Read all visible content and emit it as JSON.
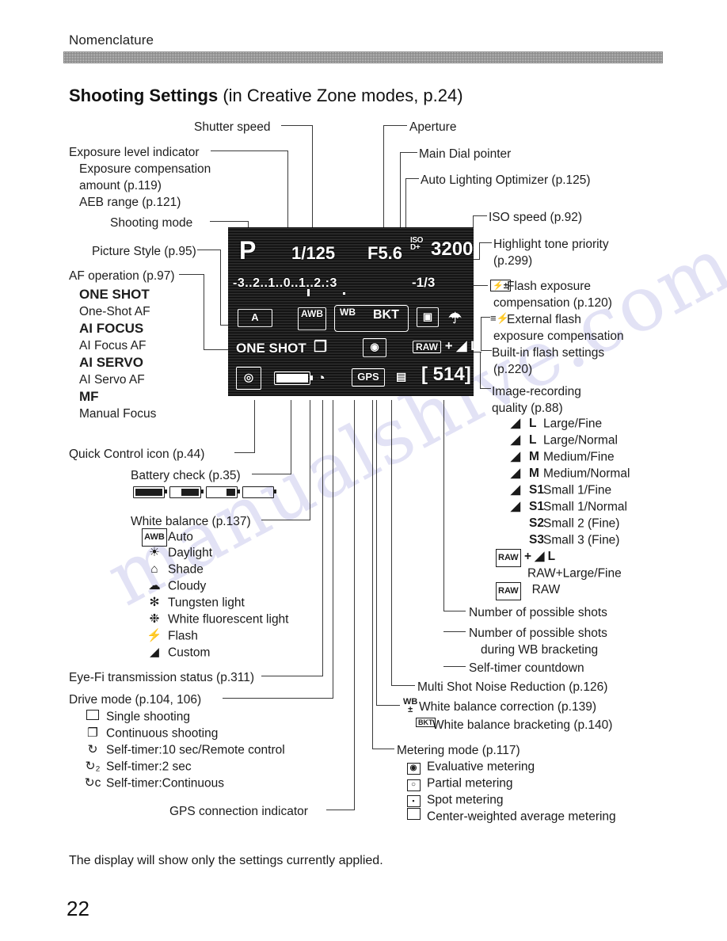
{
  "header": {
    "running_head": "Nomenclature",
    "section_title_bold": "Shooting Settings",
    "section_title_rest": " (in Creative Zone modes, p.24)"
  },
  "footer": {
    "note": "The display will show only the settings currently applied.",
    "page_number": "22"
  },
  "watermark": "manualshive.com",
  "lcd": {
    "shooting_mode": "P",
    "shutter_speed": "1/125",
    "aperture": "F5.6",
    "iso_label": "ISO",
    "highlight_tone": "D+",
    "iso_value": "3200",
    "ev_scale": "-3..2..1..0..1..2.:3",
    "flash_exp_comp": "-1/3",
    "picture_style": "A",
    "white_balance": "AWB",
    "wb_correction": "WB",
    "wb_bracketing": "BKT",
    "auto_lighting_optimizer": "ALO",
    "built_in_flash": "flash-icon",
    "af_operation": "ONE SHOT",
    "drive_mode": "continuous-icon",
    "metering_mode": "evaluative-icon",
    "image_quality": "RAW + L",
    "quick_control": "Q",
    "battery": "battery-full-icon",
    "eye_fi": "eyefi-icon",
    "gps": "GPS",
    "multi_shot_nr": "NR",
    "possible_shots": "[ 514]"
  },
  "callouts": {
    "shutter_speed": "Shutter speed",
    "aperture": "Aperture",
    "main_dial_pointer": "Main Dial pointer",
    "auto_lighting_optimizer": "Auto Lighting Optimizer (p.125)",
    "iso_speed": "ISO speed (p.92)",
    "exposure_level_indicator": "Exposure level indicator",
    "exposure_comp_amount_l1": "Exposure compensation",
    "exposure_comp_amount_l2": "amount (p.119)",
    "aeb_range": "AEB range (p.121)",
    "shooting_mode": "Shooting mode",
    "picture_style": "Picture Style (p.95)",
    "af_operation": "AF operation (p.97)",
    "quick_control_icon": "Quick Control icon (p.44)",
    "battery_check": "Battery check (p.35)",
    "white_balance": "White balance (p.137)",
    "eye_fi_status": "Eye-Fi transmission status (p.311)",
    "drive_mode": "Drive mode (p.104, 106)",
    "gps_indicator": "GPS connection indicator",
    "highlight_tone_priority_l1": "Highlight tone priority",
    "highlight_tone_priority_l2": "(p.299)",
    "flash_exp_comp_l1": "Flash exposure",
    "flash_exp_comp_l2": "compensation (p.120)",
    "external_flash_l1": "External flash",
    "external_flash_l2": "exposure compensation",
    "builtin_flash_l1": "Built-in flash settings",
    "builtin_flash_l2": "(p.220)",
    "image_quality_l1": "Image-recording",
    "image_quality_l2": "quality (p.88)",
    "possible_shots": "Number of possible shots",
    "possible_shots_wb_l1": "Number of possible shots",
    "possible_shots_wb_l2": "during WB bracketing",
    "selftimer_countdown": "Self-timer countdown",
    "multi_shot_nr": "Multi Shot Noise Reduction (p.126)",
    "wb_correction": "White balance correction (p.139)",
    "wb_bracketing": "White balance bracketing (p.140)",
    "metering_mode": "Metering mode (p.117)"
  },
  "af_list": [
    {
      "icon": "ONE SHOT",
      "label": "One-Shot AF"
    },
    {
      "icon": "AI FOCUS",
      "label": "AI Focus AF"
    },
    {
      "icon": "AI SERVO",
      "label": "AI Servo AF"
    },
    {
      "icon": "MF",
      "label": "Manual Focus"
    }
  ],
  "wb_list": [
    {
      "icon": "AWB",
      "glyph": "AWB",
      "label": "Auto"
    },
    {
      "icon": "sun-icon",
      "glyph": "☀",
      "label": "Daylight"
    },
    {
      "icon": "shade-icon",
      "glyph": "⌂",
      "label": "Shade"
    },
    {
      "icon": "cloud-icon",
      "glyph": "☁",
      "label": "Cloudy"
    },
    {
      "icon": "tungsten-icon",
      "glyph": "✻",
      "label": "Tungsten light"
    },
    {
      "icon": "fluorescent-icon",
      "glyph": "❉",
      "label": "White fluorescent light"
    },
    {
      "icon": "flash-icon",
      "glyph": "⚡",
      "label": "Flash"
    },
    {
      "icon": "custom-wb-icon",
      "glyph": "◢",
      "label": "Custom"
    }
  ],
  "drive_list": [
    {
      "icon": "single-shooting-icon",
      "glyph": "□",
      "label": "Single shooting"
    },
    {
      "icon": "continuous-shooting-icon",
      "glyph": "❐",
      "label": "Continuous shooting"
    },
    {
      "icon": "selftimer-10s-icon",
      "glyph": "↻",
      "label": "Self-timer:10 sec/Remote control"
    },
    {
      "icon": "selftimer-2s-icon",
      "glyph": "↻₂",
      "label": "Self-timer:2 sec"
    },
    {
      "icon": "selftimer-cont-icon",
      "glyph": "↻ᴄ",
      "label": "Self-timer:Continuous"
    }
  ],
  "quality_list": [
    {
      "icon": "fine-large-icon",
      "code": "L",
      "label": "Large/Fine"
    },
    {
      "icon": "normal-large-icon",
      "code": "L",
      "label": "Large/Normal"
    },
    {
      "icon": "fine-medium-icon",
      "code": "M",
      "label": "Medium/Fine"
    },
    {
      "icon": "normal-medium-icon",
      "code": "M",
      "label": "Medium/Normal"
    },
    {
      "icon": "fine-s1-icon",
      "code": "S1",
      "label": "Small 1/Fine"
    },
    {
      "icon": "normal-s1-icon",
      "code": "S1",
      "label": "Small 1/Normal"
    },
    {
      "icon": "s2-icon",
      "code": "S2",
      "label": "Small 2 (Fine)"
    },
    {
      "icon": "s3-icon",
      "code": "S3",
      "label": "Small 3 (Fine)"
    },
    {
      "icon": "raw-plus-large-icon",
      "code": "RAW + L",
      "label": "RAW+Large/Fine"
    },
    {
      "icon": "raw-icon",
      "code": "RAW",
      "label": "RAW"
    }
  ],
  "metering_list": [
    {
      "icon": "evaluative-metering-icon",
      "glyph": "◉",
      "label": "Evaluative metering"
    },
    {
      "icon": "partial-metering-icon",
      "glyph": "○",
      "label": "Partial metering"
    },
    {
      "icon": "spot-metering-icon",
      "glyph": "▪",
      "label": "Spot metering"
    },
    {
      "icon": "center-weighted-metering-icon",
      "glyph": "□",
      "label": "Center-weighted average metering"
    }
  ],
  "battery_levels": [
    100,
    66,
    33,
    0
  ]
}
